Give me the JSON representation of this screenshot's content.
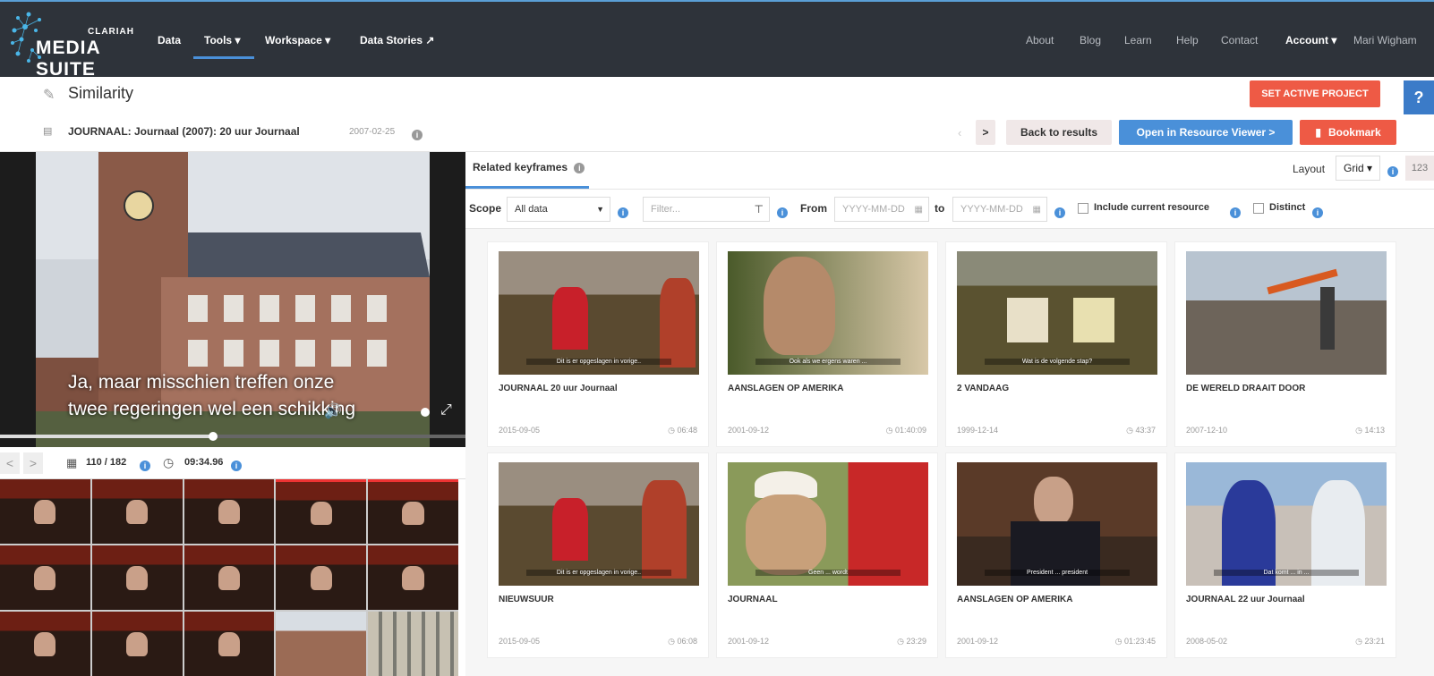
{
  "app": {
    "brand_top": "CLARIAH",
    "brand_main": "MEDIA SUITE"
  },
  "nav": {
    "left": [
      {
        "label": "Data"
      },
      {
        "label": "Tools ▾"
      },
      {
        "label": "Workspace ▾"
      },
      {
        "label": "Data Stories ↗"
      }
    ],
    "right": [
      {
        "label": "About"
      },
      {
        "label": "Blog"
      },
      {
        "label": "Learn"
      },
      {
        "label": "Help"
      },
      {
        "label": "Contact"
      },
      {
        "label": "Account ▾"
      },
      {
        "label": "Mari Wigham"
      }
    ]
  },
  "page": {
    "title": "Similarity",
    "help_label": "?"
  },
  "actions": {
    "set_active_project": "SET ACTIVE PROJECT",
    "back_to_results": "Back to results",
    "open_resource_viewer": "Open in Resource Viewer  >",
    "bookmark": "Bookmark",
    "next_arrow": ">"
  },
  "resource": {
    "title": "JOURNAAL: Journaal (2007): 20 uur Journaal",
    "date": "2007-02-25"
  },
  "player": {
    "subtitle_line1": "Ja, maar misschien treffen onze",
    "subtitle_line2": "twee regeringen wel een schikking",
    "frame_counter": "110 / 182",
    "timecode": "09:34.96",
    "prev": "<",
    "next": ">"
  },
  "panel": {
    "tab_label": "Related keyframes",
    "layout_label": "Layout",
    "layout_value": "Grid ▾",
    "size_toggle": "123"
  },
  "filters": {
    "scope_label": "Scope",
    "scope_value": "All data",
    "filter_placeholder": "Filter...",
    "from_label": "From",
    "date_placeholder": "YYYY-MM-DD",
    "to_label": "to",
    "include_current": "Include current resource",
    "distinct": "Distinct"
  },
  "results": [
    {
      "title": "JOURNAAL 20 uur Journaal",
      "date": "2015-09-05",
      "duration": "06:48"
    },
    {
      "title": "AANSLAGEN OP AMERIKA",
      "date": "2001-09-12",
      "duration": "01:40:09"
    },
    {
      "title": "2 VANDAAG",
      "date": "1999-12-14",
      "duration": "43:37"
    },
    {
      "title": "DE WERELD DRAAIT DOOR",
      "date": "2007-12-10",
      "duration": "14:13"
    },
    {
      "title": "NIEUWSUUR",
      "date": "2015-09-05",
      "duration": "06:08"
    },
    {
      "title": "JOURNAAL",
      "date": "2001-09-12",
      "duration": "23:29"
    },
    {
      "title": "AANSLAGEN OP AMERIKA",
      "date": "2001-09-12",
      "duration": "01:23:45"
    },
    {
      "title": "JOURNAAL 22 uur Journaal",
      "date": "2008-05-02",
      "duration": "23:21"
    }
  ],
  "colors": {
    "nav_bg": "#2e333a",
    "accent_red": "#ee5a45",
    "accent_blue": "#4a90d9"
  }
}
